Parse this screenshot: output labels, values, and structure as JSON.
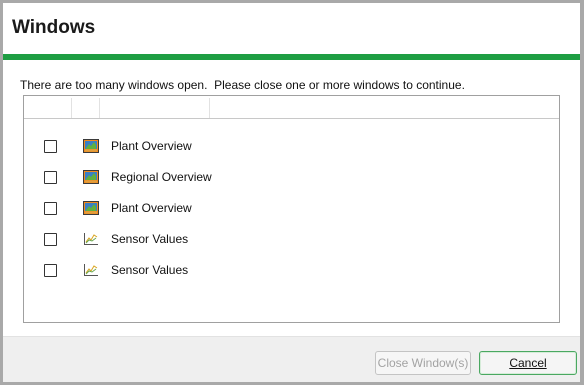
{
  "dialog": {
    "title": "Windows",
    "message": "There are too many windows open.  Please close one or more windows to continue.",
    "accent_color": "#1e9e43"
  },
  "list": {
    "rows": [
      {
        "label": "Plant Overview",
        "icon": "overview-display-icon",
        "checked": false
      },
      {
        "label": "Regional Overview",
        "icon": "overview-display-icon",
        "checked": false
      },
      {
        "label": "Plant Overview",
        "icon": "overview-display-icon",
        "checked": false
      },
      {
        "label": "Sensor Values",
        "icon": "trend-chart-icon",
        "checked": false
      },
      {
        "label": "Sensor Values",
        "icon": "trend-chart-icon",
        "checked": false
      }
    ]
  },
  "buttons": {
    "close_label": "Close Window(s)",
    "close_disabled": true,
    "cancel_label": "Cancel"
  }
}
